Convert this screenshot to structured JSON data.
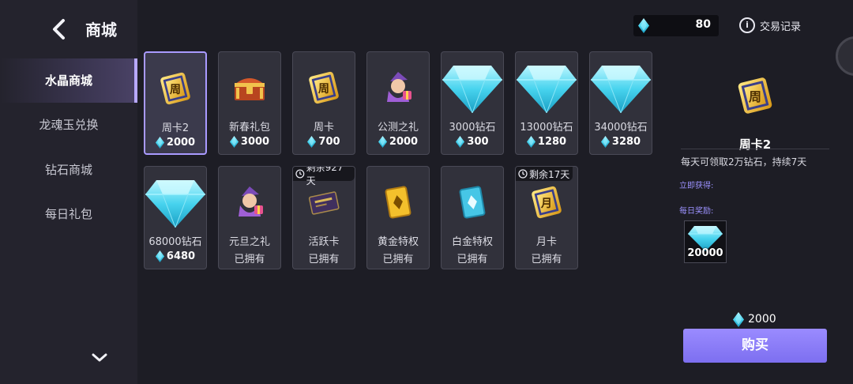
{
  "header": {
    "title": "商城"
  },
  "sidebar": {
    "items": [
      {
        "label": "水晶商城",
        "active": true
      },
      {
        "label": "龙魂玉兑换",
        "active": false
      },
      {
        "label": "钻石商城",
        "active": false
      },
      {
        "label": "每日礼包",
        "active": false
      }
    ]
  },
  "topbar": {
    "balance": "80",
    "history_label": "交易记录"
  },
  "grid": {
    "items": [
      {
        "name": "周卡2",
        "price": "2000",
        "icon": "weekly-card-icon"
      },
      {
        "name": "新春礼包",
        "price": "3000",
        "icon": "treasure-chest-icon"
      },
      {
        "name": "周卡",
        "price": "700",
        "icon": "weekly-card-icon"
      },
      {
        "name": "公测之礼",
        "price": "2000",
        "icon": "wizard-gift-icon"
      },
      {
        "name": "3000钻石",
        "price": "300",
        "icon": "diamond-icon"
      },
      {
        "name": "13000钻石",
        "price": "1280",
        "icon": "diamond-icon"
      },
      {
        "name": "34000钻石",
        "price": "3280",
        "icon": "diamond-icon"
      },
      {
        "name": "68000钻石",
        "price": "6480",
        "icon": "diamond-icon"
      },
      {
        "name": "元旦之礼",
        "status": "已拥有",
        "icon": "wizard-gift-icon"
      },
      {
        "name": "活跃卡",
        "status": "已拥有",
        "timer": "剩余927天",
        "icon": "active-card-icon"
      },
      {
        "name": "黄金特权",
        "status": "已拥有",
        "icon": "gold-privilege-icon"
      },
      {
        "name": "白金特权",
        "status": "已拥有",
        "icon": "platinum-privilege-icon"
      },
      {
        "name": "月卡",
        "status": "已拥有",
        "timer": "剩余17天",
        "icon": "monthly-card-icon"
      }
    ]
  },
  "detail": {
    "name": "周卡2",
    "icon_char": "周",
    "month_char": "月",
    "description": "每天可领取2万钻石，持续7天",
    "instant_label": "立即获得:",
    "daily_label": "每日奖励:",
    "reward_amount": "20000",
    "buy_price": "2000",
    "buy_label": "购买"
  },
  "colors": {
    "accent": "#9a8bff",
    "gem": "#5fd8f0",
    "panel": "#31313b",
    "background": "#1d1d25"
  }
}
